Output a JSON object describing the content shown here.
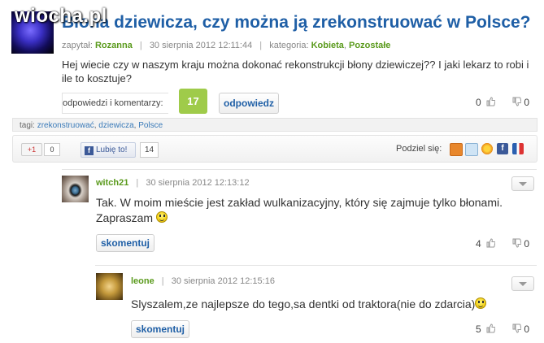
{
  "watermark": "wiocha.pl",
  "question": {
    "title": "Błona dziewicza, czy można ją zrekonstruować w Polsce?",
    "asked_label": "zapytał:",
    "author": "Rozanna",
    "date": "30 sierpnia 2012 12:11:44",
    "category_label": "kategoria:",
    "category_1": "Kobieta",
    "category_2": "Pozostałe",
    "body": "Hej wiecie czy w naszym kraju można dokonać rekonstrukcji błony dziewiczej?? I jaki lekarz to robi i ile to kosztuje?",
    "comments_label": "odpowiedzi i komentarzy:",
    "comments_count": "17",
    "answer_button": "odpowiedz",
    "votes_up": "0",
    "votes_down": "0"
  },
  "tags": {
    "label": "tagi:",
    "items": [
      "zrekonstruować",
      "dziewicza",
      "Polsce"
    ]
  },
  "share": {
    "gplus_label": "+1",
    "gplus_count": "0",
    "fb_like_label": "Lubię to!",
    "fb_count": "14",
    "share_label": "Podziel się:"
  },
  "comments": [
    {
      "user": "witch21",
      "date": "30 sierpnia 2012 12:13:12",
      "text": "Tak. W moim mieście jest zakład wulkanizacyjny, który się zajmuje tylko błonami. Zapraszam",
      "reply_button": "skomentuj",
      "votes_up": "4",
      "votes_down": "0"
    },
    {
      "user": "leone",
      "date": "30 sierpnia 2012 12:15:16",
      "text": "Slyszalem,ze najlepsze do tego,sa dentki od traktora(nie do zdarcia)",
      "reply_button": "skomentuj",
      "votes_up": "5",
      "votes_down": "0"
    }
  ],
  "colors": {
    "title": "#1f5fa6",
    "username": "#5a9a1c",
    "count_badge": "#9fcb4a",
    "facebook": "#3b5998"
  }
}
